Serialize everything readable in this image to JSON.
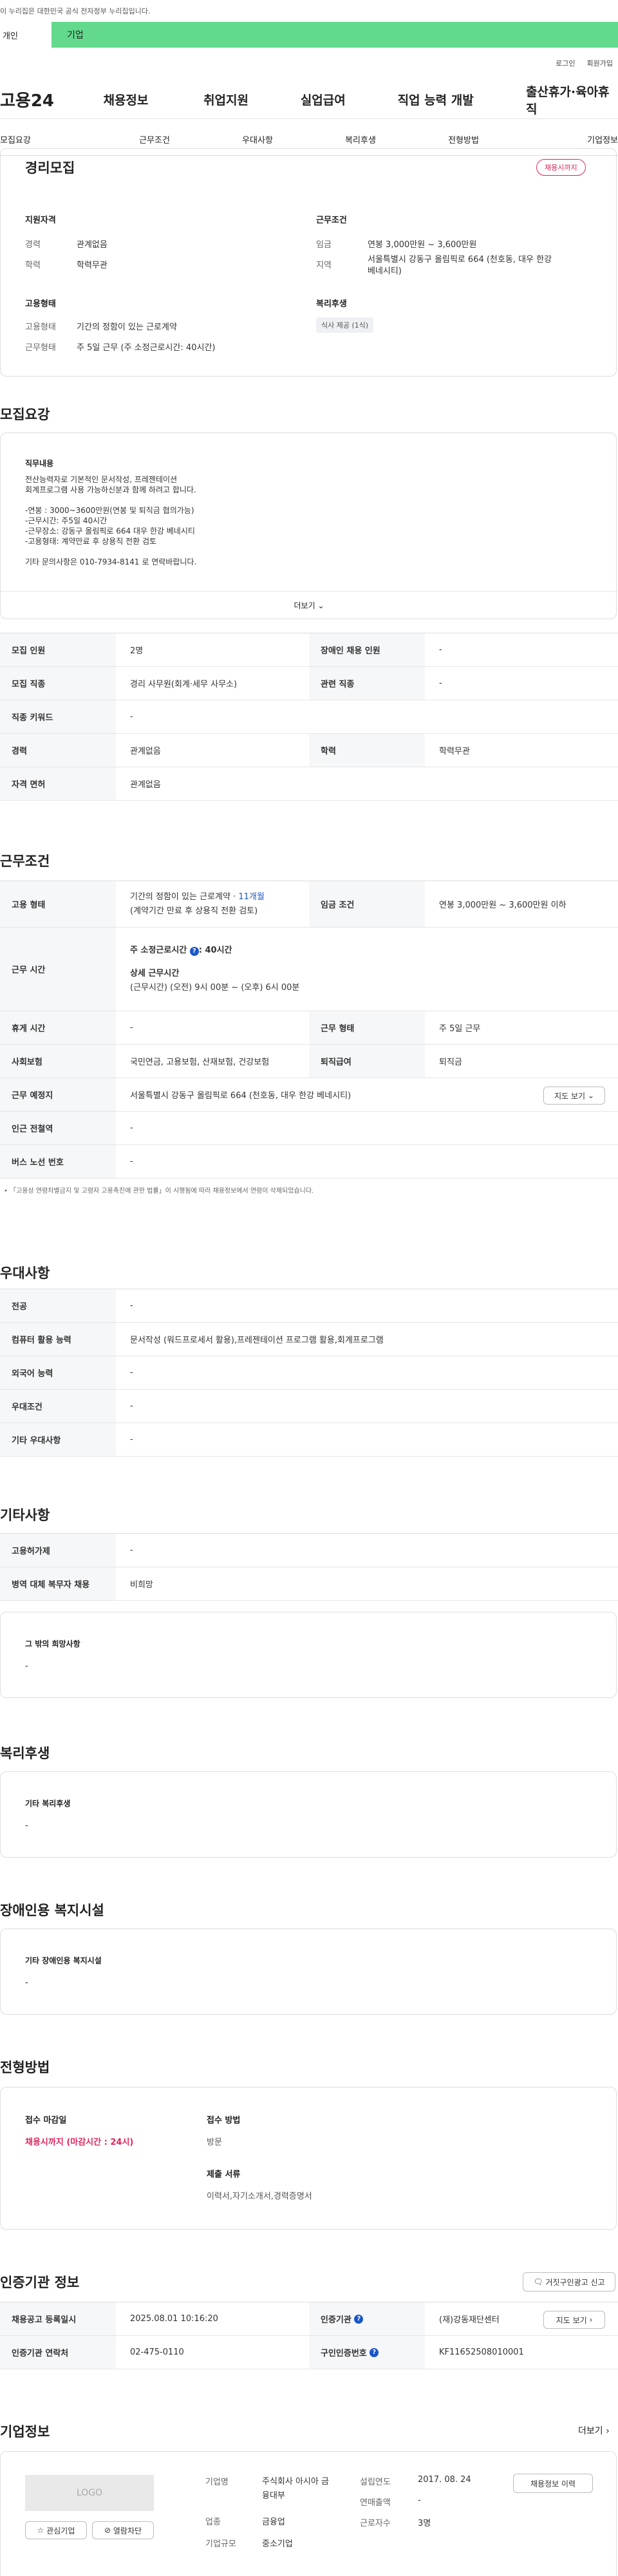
{
  "gov_banner": "이 누리집은 대한민국 공식 전자정부 누리집입니다.",
  "service_tabs": [
    "개인",
    "기업"
  ],
  "util": [
    "로그인",
    "회원가입"
  ],
  "nav": {
    "logo": "고용24",
    "menus": [
      "채용정보",
      "취업지원",
      "실업급여",
      "직업 능력 개발",
      "출산휴가·육아휴직"
    ]
  },
  "section_tabs": [
    "모집요강",
    "근무조건",
    "우대사항",
    "복리후생",
    "전형방법",
    "기업정보"
  ],
  "summary": {
    "title": "경리모집",
    "badge": "채용시까지",
    "left": {
      "g1": "지원자격",
      "g1_items": [
        [
          "경력",
          "관계없음"
        ],
        [
          "학력",
          "학력무관"
        ]
      ],
      "g2": "고용형태",
      "g2_items": [
        [
          "고용형태",
          "기간의 정함이 있는 근로계약"
        ],
        [
          "근무형태",
          "주 5일 근무 (주 소정근로시간: 40시간)"
        ]
      ]
    },
    "right": {
      "g1": "근무조건",
      "g1_items": [
        [
          "임금",
          "연봉 3,000만원 ~ 3,600만원"
        ],
        [
          "지역",
          "서울특별시 강동구 올림픽로 664 (천호동, 대우 한강 베네시티)"
        ]
      ],
      "g2": "복리후생",
      "tag": "식사 제공 (1식)"
    }
  },
  "recruit": {
    "title": "모집요강",
    "box_title": "직무내용",
    "lines": [
      "전산능력자로 기본적인 문서작성, 프레젠테이션",
      "회계프로그램 사용 가능하신분과 함께 하려고 합니다.",
      "",
      "-연봉 : 3000~3600만원(연봉 및 퇴직금 협의가능)",
      "-근무시간: 주5일 40시간",
      "-근무장소: 강동구 올림픽로 664 대우 한강 베네시티",
      "-고용형태: 계약만료 후 상용직 전환 검토",
      "",
      "기타 문의사항은 010-7934-8141 로 연락바랍니다."
    ],
    "more": "더보기",
    "rows": [
      [
        [
          "모집 인원",
          "2명"
        ],
        [
          "장애인 채용 인원",
          "-"
        ]
      ],
      [
        [
          "모집 직종",
          "경리 사무원(회계·세무 사무소)"
        ],
        [
          "관련 직종",
          "-"
        ]
      ],
      [
        [
          "직종 키워드",
          "-"
        ]
      ],
      [
        [
          "경력",
          "관계없음"
        ],
        [
          "학력",
          "학력무관"
        ]
      ],
      [
        [
          "자격 면허",
          "관계없음"
        ]
      ]
    ]
  },
  "work": {
    "title": "근무조건",
    "employ_label": "고용 형태",
    "employ_value": "기간의 정함이 있는 근로계약 · ",
    "employ_months": "11개월",
    "employ_note": "(계약기간 만료 후 상용직 전환 검토)",
    "wage_label": "임금 조건",
    "wage_value": "연봉 3,000만원 ~ 3,600만원 이하",
    "hours_label": "근무 시간",
    "hours_weekly": "주 소정근로시간 ",
    "hours_weekly_val": ": 40시간",
    "hours_detail_title": "상세 근무시간",
    "hours_detail": "(근무시간) (오전) 9시 00분 ~ (오후) 6시 00분",
    "rest_label": "휴게 시간",
    "rest_value": "-",
    "shift_label": "근무 형태",
    "shift_value": "주 5일 근무",
    "ins_label": "사회보험",
    "ins_value": "국민연금, 고용보험, 산재보험, 건강보험",
    "sev_label": "퇴직급여",
    "sev_value": "퇴직금",
    "loc_label": "근무 예정지",
    "loc_value": "서울특별시 강동구 올림픽로 664 (천호동, 대우 한강 베네시티)",
    "map_btn": "지도 보기",
    "sub_label": "인근 전철역",
    "sub_value": "-",
    "bus_label": "버스 노선 번호",
    "bus_value": "-",
    "note": "「고용상 연령차별금지 및 고령자 고용촉진에 관한 법률」이 시행됨에 따라 채용정보에서 연령이 삭제되었습니다."
  },
  "pref": {
    "title": "우대사항",
    "rows": [
      [
        "전공",
        "-"
      ],
      [
        "컴퓨터 활용 능력",
        "문서작성 (워드프로세서 활용),프레젠테이션 프로그램 활용,회계프로그램"
      ],
      [
        "외국어 능력",
        "-"
      ],
      [
        "우대조건",
        "-"
      ],
      [
        "기타 우대사항",
        "-"
      ]
    ]
  },
  "etc": {
    "title": "기타사항",
    "rows": [
      [
        "고용허가제",
        "-"
      ],
      [
        "병역 대체 복무자 채용",
        "비희망"
      ]
    ],
    "box_title": "그 밖의 희망사항",
    "box_value": "-"
  },
  "welfare": {
    "title": "복리후생",
    "box_title": "기타 복리후생",
    "box_value": "-"
  },
  "disab": {
    "title": "장애인용 복지시설",
    "box_title": "기타 장애인용 복지시설",
    "box_value": "-"
  },
  "select": {
    "title": "전형방법",
    "deadline_label": "접수 마감일",
    "deadline_value": "채용시까지 (마감시간 : 24시)",
    "method_label": "접수 방법",
    "method_value": "방문",
    "docs_label": "제출 서류",
    "docs_value": "이력서,자기소개서,경력증명서"
  },
  "agency": {
    "title": "인증기관 정보",
    "report_btn": "거짓구인광고 신고",
    "rows": [
      [
        "채용공고 등록일시",
        "2025.08.01 10:16:20",
        "인증기관",
        "(재)강동재단센터"
      ],
      [
        "인증기관 연락처",
        "02-475-0110",
        "구인인증번호",
        "KF11652508010001"
      ]
    ],
    "map_btn": "지도 보기"
  },
  "company": {
    "title": "기업정보",
    "more": "더보기",
    "logo": "LOGO",
    "fav": "관심기업",
    "block": "열람차단",
    "info_btn": "채용정보 이력",
    "fields": [
      [
        "기업명",
        "주식회사 아시아 금융대부"
      ],
      [
        "업종",
        "금융업"
      ],
      [
        "기업규모",
        "중소기업"
      ]
    ],
    "fields2": [
      [
        "설립연도",
        "2017. 08. 24"
      ],
      [
        "연매출액",
        "-"
      ],
      [
        "근로자수",
        "3명"
      ]
    ]
  },
  "colors": {
    "accent": "#62d98c",
    "badge": "#e0245e",
    "link": "#1a56c9"
  }
}
